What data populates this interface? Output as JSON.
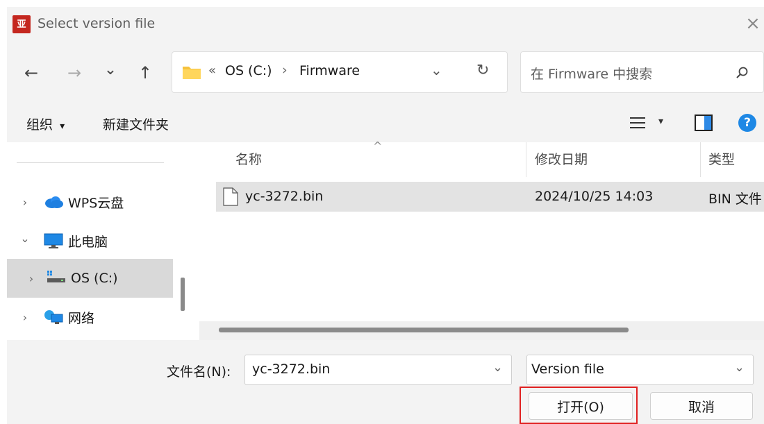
{
  "window": {
    "title": "Select version file",
    "close_glyph": "×"
  },
  "nav": {
    "back_glyph": "←",
    "forward_glyph": "→",
    "recent_glyph": "⌄",
    "up_glyph": "↑",
    "breadcrumb": {
      "overflow": "«",
      "segments": [
        "OS (C:)",
        "Firmware"
      ],
      "separator": "›"
    },
    "refresh_glyph": "↻",
    "search_placeholder": "在 Firmware 中搜索"
  },
  "commands": {
    "organize": "组织",
    "organize_arrow": "▾",
    "new_folder": "新建文件夹",
    "view_arrow": "▾",
    "help_glyph": "?"
  },
  "sidebar": {
    "items": [
      {
        "label": "WPS云盘",
        "chevron": "›",
        "icon": "cloud-icon"
      },
      {
        "label": "此电脑",
        "chevron": "⌄",
        "icon": "computer-icon"
      },
      {
        "label": "OS (C:)",
        "chevron": "›",
        "icon": "drive-icon"
      },
      {
        "label": "网络",
        "chevron": "›",
        "icon": "network-icon"
      }
    ]
  },
  "file_list": {
    "sort_indicator": "^",
    "columns": [
      "名称",
      "修改日期",
      "类型"
    ],
    "rows": [
      {
        "name": "yc-3272.bin",
        "modified": "2024/10/25 14:03",
        "type": "BIN 文件"
      }
    ]
  },
  "footer": {
    "filename_label": "文件名(N):",
    "filename_value": "yc-3272.bin",
    "filetype_value": "Version file",
    "open_button": "打开(O)",
    "cancel_button": "取消"
  },
  "colors": {
    "accent": "#1a73e8",
    "highlight_border": "#e02020",
    "app_icon": "#c4271f"
  }
}
